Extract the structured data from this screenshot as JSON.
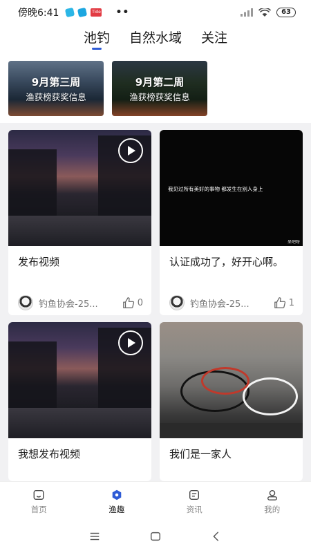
{
  "status_bar": {
    "time": "傍晚6:41",
    "app_badge": "Tide",
    "more": "••",
    "battery": "63"
  },
  "top_tabs": [
    {
      "label": "池钓",
      "active": true
    },
    {
      "label": "自然水域",
      "active": false
    },
    {
      "label": "关注",
      "active": false
    }
  ],
  "banners": [
    {
      "title": "9月第三周",
      "subtitle": "渔获榜获奖信息"
    },
    {
      "title": "9月第二周",
      "subtitle": "渔获榜获奖信息"
    }
  ],
  "posts": [
    {
      "title": "发布视频",
      "author": "钓鱼协会-25...",
      "likes": "0",
      "media": "video",
      "icon": "play-icon"
    },
    {
      "title": "认证成功了，好开心啊。",
      "author": "钓鱼协会-25...",
      "likes": "1",
      "media": "text-image",
      "overlay_text": "我见过所有美好的事物 都发生在别人身上",
      "watermark": "呆吧呀"
    },
    {
      "title": "我想发布视频",
      "media": "video",
      "icon": "play-icon"
    },
    {
      "title": "我们是一家人",
      "media": "photo"
    }
  ],
  "bottom_nav": [
    {
      "label": "首页",
      "icon": "home-icon",
      "active": false
    },
    {
      "label": "渔趣",
      "icon": "fish-icon",
      "active": true
    },
    {
      "label": "资讯",
      "icon": "news-icon",
      "active": false
    },
    {
      "label": "我的",
      "icon": "profile-icon",
      "active": false
    }
  ],
  "colors": {
    "accent": "#2e5bd6",
    "background": "#f1f1f3"
  }
}
